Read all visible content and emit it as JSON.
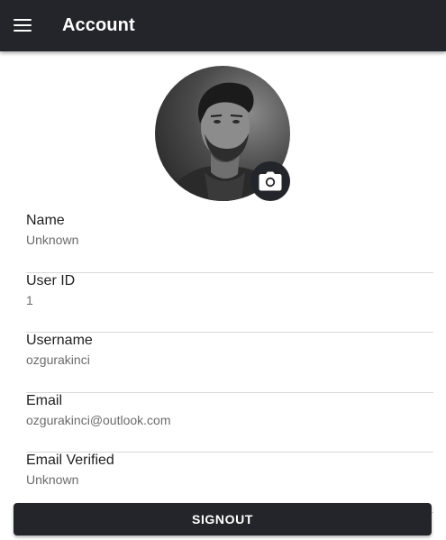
{
  "appbar": {
    "title": "Account",
    "menu_icon": "hamburger-menu-icon"
  },
  "profile": {
    "avatar": "user-portrait-photo",
    "camera_icon": "camera-icon"
  },
  "fields": [
    {
      "label": "Name",
      "value": "Unknown"
    },
    {
      "label": "User ID",
      "value": "1"
    },
    {
      "label": "Username",
      "value": "ozgurakinci"
    },
    {
      "label": "Email",
      "value": "ozgurakinci@outlook.com"
    },
    {
      "label": "Email Verified",
      "value": "Unknown"
    }
  ],
  "actions": {
    "signout_label": "SIGNOUT"
  },
  "colors": {
    "primary_dark": "#24252a",
    "background": "#ffffff",
    "divider": "#d9d9d9",
    "secondary_text": "#6b6b6b"
  }
}
